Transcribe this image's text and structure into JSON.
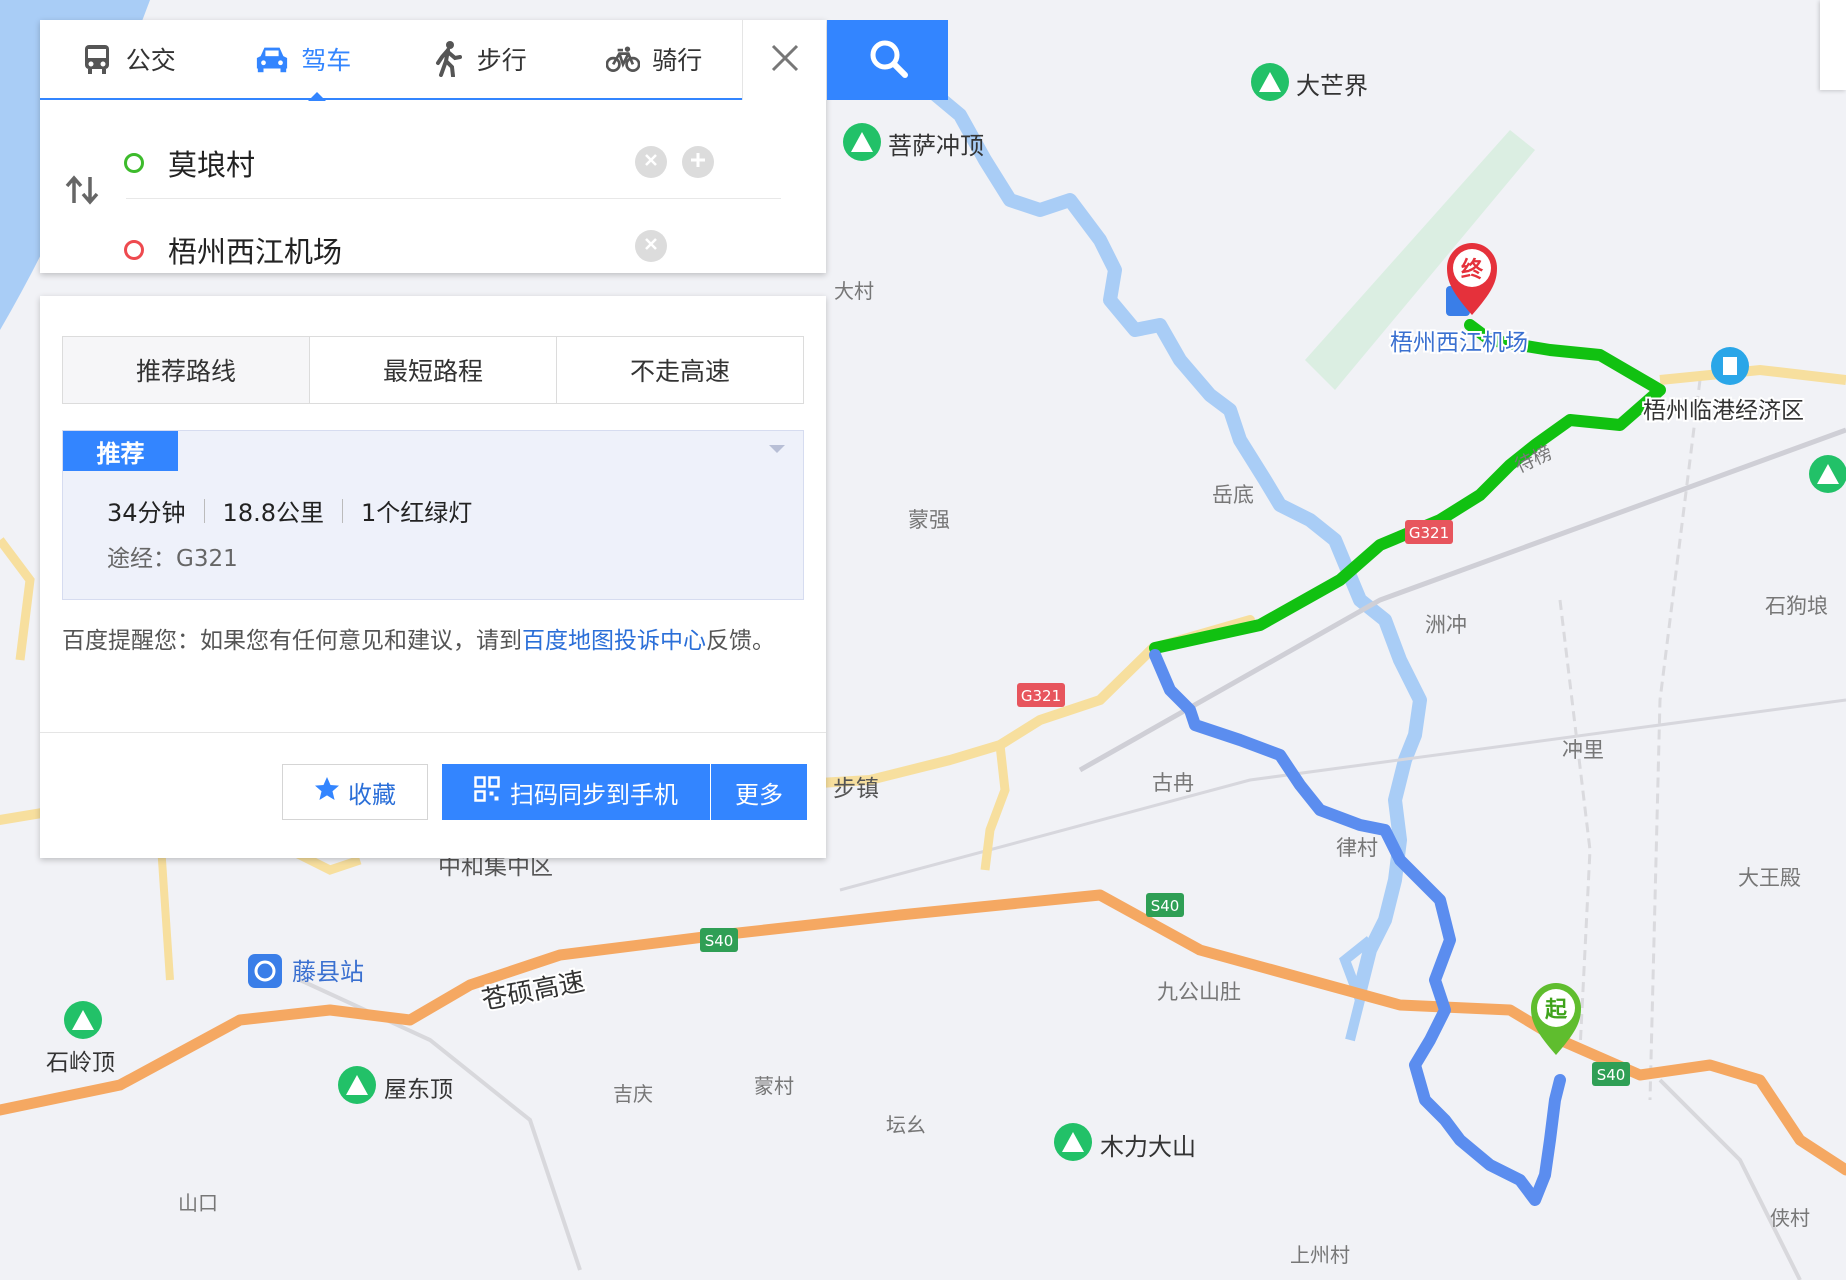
{
  "modes": [
    {
      "label": "公交",
      "icon": "bus-icon"
    },
    {
      "label": "驾车",
      "icon": "car-icon"
    },
    {
      "label": "步行",
      "icon": "walk-icon"
    },
    {
      "label": "骑行",
      "icon": "bike-icon"
    }
  ],
  "active_mode": "驾车",
  "origin": "莫埌村",
  "destination": "梧州西江机场",
  "route_tabs": [
    "推荐路线",
    "最短路程",
    "不走高速"
  ],
  "route": {
    "badge": "推荐",
    "duration": "34分钟",
    "distance": "18.8公里",
    "lights": "1个红绿灯",
    "via": "途经：G321"
  },
  "tip": {
    "prefix": "百度提醒您：如果您有任何意见和建议，请到",
    "link": "百度地图投诉中心",
    "suffix": "反馈。"
  },
  "buttons": {
    "favorite": "收藏",
    "sync": "扫码同步到手机",
    "more": "更多"
  },
  "markers": {
    "start": "起",
    "end": "终"
  },
  "colors": {
    "accent": "#3385ff",
    "route_green": "#11c111",
    "route_blue": "#5b8def",
    "highway": "#f5a862",
    "river": "#a9cdf6"
  },
  "map_labels": {
    "mt_damangjie": "大芒界",
    "mt_pusachongding": "菩萨冲顶",
    "dacun": "大村",
    "airport": "梧州西江机场",
    "linggang": "梧州临港经济区",
    "daimiao": "待榜",
    "yuedi": "岳底",
    "mengqiang": "蒙强",
    "zhouchong": "洲冲",
    "shigoulang": "石狗埌",
    "chongli": "冲里",
    "gunai": "古冉",
    "lvcun": "律村",
    "buzhen": "步镇",
    "zhonghe": "中和集中区",
    "tengxian": "藤县站",
    "cangshuo": "苍硕高速",
    "dawangdian": "大王殿",
    "jiugongshan": "九公山肚",
    "shilingding": "石岭顶",
    "wudongding": "屋东顶",
    "jiqing": "吉庆",
    "mengcun": "蒙村",
    "tanyao": "坛幺",
    "mulidashan": "木力大山",
    "shankou": "山口",
    "shangzhoucun": "上州村",
    "xiacun": "侠村",
    "g321a": "G321",
    "g321b": "G321",
    "s40a": "S40",
    "s40b": "S40",
    "s40c": "S40"
  }
}
